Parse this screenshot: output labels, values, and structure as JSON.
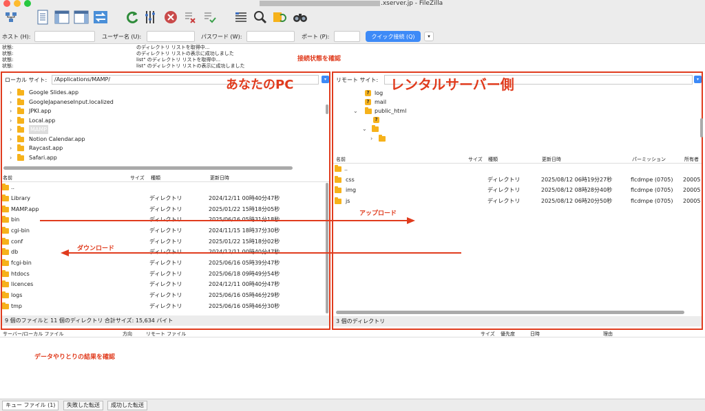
{
  "window": {
    "title_suffix": ".xserver.jp - FileZilla"
  },
  "toolbar": {
    "icons": [
      "site-manager-icon",
      "toggle-log-icon",
      "toggle-local-tree-icon",
      "toggle-remote-tree-icon",
      "transfer-queue-icon",
      "refresh-icon",
      "process-queue-icon",
      "cancel-icon",
      "disconnect-icon",
      "reconnect-icon",
      "filter-icon",
      "compare-icon",
      "sync-browse-icon",
      "search-icon"
    ]
  },
  "quickconnect": {
    "host_label": "ホスト (H):",
    "user_label": "ユーザー名 (U):",
    "pass_label": "パスワード (W):",
    "port_label": "ポート (P):",
    "button_label": "クイック接続 (Q)"
  },
  "log": {
    "rows": [
      {
        "label": "状態:",
        "message": "のディレクトリ リストを取得中..."
      },
      {
        "label": "状態:",
        "message": "のディレクトリ リストの表示に成功しました"
      },
      {
        "label": "状態:",
        "message": "list\" のディレクトリ リストを取得中..."
      },
      {
        "label": "状態:",
        "message": "list\" のディレクトリ リストの表示に成功しました"
      }
    ]
  },
  "annotations": {
    "connection": "接続状態を確認",
    "local_pc": "あなたのPC",
    "remote": "レンタルサーバー側",
    "upload": "アップロード",
    "download": "ダウンロード",
    "result": "データやりとりの結果を確認",
    "color": "#e03b1d"
  },
  "local": {
    "site_label": "ローカル サイト:",
    "path": "/Applications/MAMP/",
    "tree": [
      {
        "name": "Google Slides.app"
      },
      {
        "name": "GoogleJapaneseInput.localized"
      },
      {
        "name": "JPKI.app"
      },
      {
        "name": "Local.app"
      },
      {
        "name": "MAMP",
        "selected": true
      },
      {
        "name": "Notion Calendar.app"
      },
      {
        "name": "Raycast.app"
      },
      {
        "name": "Safari.app"
      }
    ],
    "columns": {
      "name": "名前",
      "size": "サイズ",
      "type": "種類",
      "modified": "更新日時"
    },
    "files": [
      {
        "name": "..",
        "type": "",
        "modified": ""
      },
      {
        "name": "Library",
        "type": "ディレクトリ",
        "modified": "2024/12/11 00時40分47秒"
      },
      {
        "name": "MAMP.app",
        "type": "ディレクトリ",
        "modified": "2025/01/22 15時18分05秒"
      },
      {
        "name": "bin",
        "type": "ディレクトリ",
        "modified": "2025/06/16 05時31分18秒"
      },
      {
        "name": "cgi-bin",
        "type": "ディレクトリ",
        "modified": "2024/11/15 18時37分30秒"
      },
      {
        "name": "conf",
        "type": "ディレクトリ",
        "modified": "2025/01/22 15時18分02秒"
      },
      {
        "name": "db",
        "type": "ディレクトリ",
        "modified": "2024/12/11 00時40分47秒"
      },
      {
        "name": "fcgi-bin",
        "type": "ディレクトリ",
        "modified": "2025/06/16 05時39分47秒"
      },
      {
        "name": "htdocs",
        "type": "ディレクトリ",
        "modified": "2025/06/18 09時49分54秒"
      },
      {
        "name": "licences",
        "type": "ディレクトリ",
        "modified": "2024/12/11 00時40分47秒"
      },
      {
        "name": "logs",
        "type": "ディレクトリ",
        "modified": "2025/06/16 05時46分29秒"
      },
      {
        "name": "tmp",
        "type": "ディレクトリ",
        "modified": "2025/06/16 05時46分30秒"
      }
    ],
    "status": "9 個のファイルと 11 個のディレクトリ 合計サイズ: 15,634 バイト"
  },
  "remote": {
    "site_label": "リモート サイト:",
    "path": "",
    "tree": [
      {
        "name": "log",
        "icon": "question"
      },
      {
        "name": "mail",
        "icon": "question"
      },
      {
        "name": "public_html",
        "icon": "folder",
        "expanded": true
      },
      {
        "name": "",
        "icon": "question"
      },
      {
        "name": "",
        "icon": "folder",
        "expanded": true
      },
      {
        "name": "",
        "icon": "folder"
      }
    ],
    "columns": {
      "name": "名前",
      "size": "サイズ",
      "type": "種類",
      "modified": "更新日時",
      "perm": "パーミッション",
      "owner": "所有者"
    },
    "files": [
      {
        "name": "..",
        "type": "",
        "modified": "",
        "perm": "",
        "owner": ""
      },
      {
        "name": "css",
        "type": "ディレクトリ",
        "modified": "2025/08/12 06時19分27秒",
        "perm": "flcdmpe (0705)",
        "owner": "20005"
      },
      {
        "name": "img",
        "type": "ディレクトリ",
        "modified": "2025/08/12 08時28分40秒",
        "perm": "flcdmpe (0705)",
        "owner": "20005"
      },
      {
        "name": "js",
        "type": "ディレクトリ",
        "modified": "2025/08/12 06時20分50秒",
        "perm": "flcdmpe (0705)",
        "owner": "20005"
      }
    ],
    "status": "3 個のディレクトリ"
  },
  "queue": {
    "columns": {
      "file": "サーバー/ローカル ファイル",
      "direction": "方向",
      "remote": "リモート ファイル",
      "size": "サイズ",
      "priority": "優先度",
      "time": "日時",
      "reason": "理由"
    },
    "tabs": [
      "キュー ファイル (1)",
      "失敗した転送",
      "成功した転送"
    ]
  }
}
